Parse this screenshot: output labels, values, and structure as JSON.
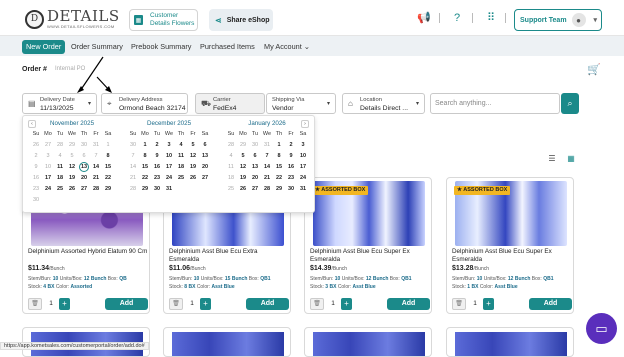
{
  "header": {
    "logo_name": "DETAILS",
    "logo_sub": "WWW.DETAILSFLOWERS.COM",
    "customer_label": "Customer",
    "customer_name": "Details Flowers",
    "share_label": "Share eShop",
    "support_label": "Support Team"
  },
  "nav": {
    "items": [
      "New Order",
      "Order Summary",
      "Prebook Summary",
      "Purchased Items",
      "My Account"
    ]
  },
  "order": {
    "label": "Order #",
    "placeholder": "Internal PO"
  },
  "filters": {
    "delivery_date_label": "Delivery Date",
    "delivery_date_value": "11/13/2025",
    "delivery_address_label": "Delivery Address",
    "delivery_address_value": "Ormond Beach 32174",
    "carrier_label": "Carrier",
    "carrier_value": "FedEx4",
    "shipping_label": "Shipping Via",
    "shipping_value": "Vendor",
    "location_label": "Location",
    "location_value": "Details Direct ...",
    "search_placeholder": "Search anything..."
  },
  "calendar": {
    "dows": [
      "Su",
      "Mo",
      "Tu",
      "We",
      "Th",
      "Fr",
      "Sa"
    ],
    "months": [
      {
        "title": "November 2025",
        "days": [
          [
            "26",
            1
          ],
          [
            "27",
            1
          ],
          [
            "28",
            1
          ],
          [
            "29",
            1
          ],
          [
            "30",
            1
          ],
          [
            "31",
            1
          ],
          [
            "1",
            1
          ],
          [
            "2",
            1
          ],
          [
            "3",
            1
          ],
          [
            "4",
            1
          ],
          [
            "5",
            1
          ],
          [
            "6",
            1
          ],
          [
            "7",
            1
          ],
          [
            "8",
            0
          ],
          [
            "9",
            1
          ],
          [
            "10",
            1
          ],
          [
            "11",
            0
          ],
          [
            "12",
            0
          ],
          [
            "13",
            2
          ],
          [
            "14",
            0
          ],
          [
            "15",
            0
          ],
          [
            "16",
            1
          ],
          [
            "17",
            0
          ],
          [
            "18",
            0
          ],
          [
            "19",
            0
          ],
          [
            "20",
            0
          ],
          [
            "21",
            0
          ],
          [
            "22",
            0
          ],
          [
            "23",
            1
          ],
          [
            "24",
            0
          ],
          [
            "25",
            0
          ],
          [
            "26",
            0
          ],
          [
            "27",
            0
          ],
          [
            "28",
            0
          ],
          [
            "29",
            0
          ],
          [
            "30",
            1
          ]
        ]
      },
      {
        "title": "December 2025",
        "days": [
          [
            "30",
            1
          ],
          [
            "1",
            0
          ],
          [
            "2",
            0
          ],
          [
            "3",
            0
          ],
          [
            "4",
            0
          ],
          [
            "5",
            0
          ],
          [
            "6",
            0
          ],
          [
            "7",
            1
          ],
          [
            "8",
            0
          ],
          [
            "9",
            0
          ],
          [
            "10",
            0
          ],
          [
            "11",
            0
          ],
          [
            "12",
            0
          ],
          [
            "13",
            0
          ],
          [
            "14",
            1
          ],
          [
            "15",
            0
          ],
          [
            "16",
            0
          ],
          [
            "17",
            0
          ],
          [
            "18",
            0
          ],
          [
            "19",
            0
          ],
          [
            "20",
            0
          ],
          [
            "21",
            1
          ],
          [
            "22",
            0
          ],
          [
            "23",
            0
          ],
          [
            "24",
            0
          ],
          [
            "25",
            0
          ],
          [
            "26",
            0
          ],
          [
            "27",
            0
          ],
          [
            "28",
            1
          ],
          [
            "29",
            0
          ],
          [
            "30",
            0
          ],
          [
            "31",
            0
          ]
        ]
      },
      {
        "title": "January 2026",
        "days": [
          [
            "28",
            1
          ],
          [
            "29",
            1
          ],
          [
            "30",
            1
          ],
          [
            "31",
            1
          ],
          [
            "1",
            0
          ],
          [
            "2",
            0
          ],
          [
            "3",
            0
          ],
          [
            "4",
            1
          ],
          [
            "5",
            0
          ],
          [
            "6",
            0
          ],
          [
            "7",
            0
          ],
          [
            "8",
            0
          ],
          [
            "9",
            0
          ],
          [
            "10",
            0
          ],
          [
            "11",
            1
          ],
          [
            "12",
            0
          ],
          [
            "13",
            0
          ],
          [
            "14",
            0
          ],
          [
            "15",
            0
          ],
          [
            "16",
            0
          ],
          [
            "17",
            0
          ],
          [
            "18",
            1
          ],
          [
            "19",
            0
          ],
          [
            "20",
            0
          ],
          [
            "21",
            0
          ],
          [
            "22",
            0
          ],
          [
            "23",
            0
          ],
          [
            "24",
            0
          ],
          [
            "25",
            1
          ],
          [
            "26",
            0
          ],
          [
            "27",
            0
          ],
          [
            "28",
            0
          ],
          [
            "29",
            0
          ],
          [
            "30",
            0
          ],
          [
            "31",
            0
          ]
        ]
      }
    ]
  },
  "products": [
    {
      "name": "Delphinium Assorted Hybrid Elatum 90 Cm",
      "price": "11.34",
      "unit": "/Bunch",
      "stem": "Stem/Bun:",
      "stem_v": "10",
      "units": "Units/Box:",
      "units_v": "12 Bunch",
      "box": "Box:",
      "box_v": "QB",
      "stock": "Stock:",
      "stock_v": "4 BX",
      "color": "Color:",
      "color_v": "Assorted",
      "badge": "",
      "qty": "1",
      "add": "Add"
    },
    {
      "name": "Delphinium Asst Blue Ecu Extra Esmeralda",
      "price": "11.06",
      "unit": "/Bunch",
      "stem": "Stem/Bun:",
      "stem_v": "10",
      "units": "Units/Box:",
      "units_v": "15 Bunch",
      "box": "Box:",
      "box_v": "QB1",
      "stock": "Stock:",
      "stock_v": "8 BX",
      "color": "Color:",
      "color_v": "Asst Blue",
      "badge": "",
      "qty": "1",
      "add": "Add"
    },
    {
      "name": "Delphinium Asst Blue Ecu Super Ex Esmeralda",
      "price": "14.39",
      "unit": "/Bunch",
      "stem": "Stem/Bun:",
      "stem_v": "10",
      "units": "Units/Box:",
      "units_v": "12 Bunch",
      "box": "Box:",
      "box_v": "QB1",
      "stock": "Stock:",
      "stock_v": "3 BX",
      "color": "Color:",
      "color_v": "Asst Blue",
      "badge": "ASSORTED BOX",
      "qty": "1",
      "add": "Add"
    },
    {
      "name": "Delphinium Asst Blue Ecu Super Ex Esmeralda",
      "price": "13.28",
      "unit": "/Bunch",
      "stem": "Stem/Bun:",
      "stem_v": "10",
      "units": "Units/Box:",
      "units_v": "12 Bunch",
      "box": "Box:",
      "box_v": "QB1",
      "stock": "Stock:",
      "stock_v": "1 BX",
      "color": "Color:",
      "color_v": "Asst Blue",
      "badge": "ASSORTED BOX",
      "qty": "1",
      "add": "Add"
    }
  ],
  "status_url": "https://app.kometsales.com/customerportal/order/add.do#",
  "colors": {
    "accent": "#1b8a8a",
    "badge": "#f2b622",
    "chat": "#5a2ebc"
  }
}
